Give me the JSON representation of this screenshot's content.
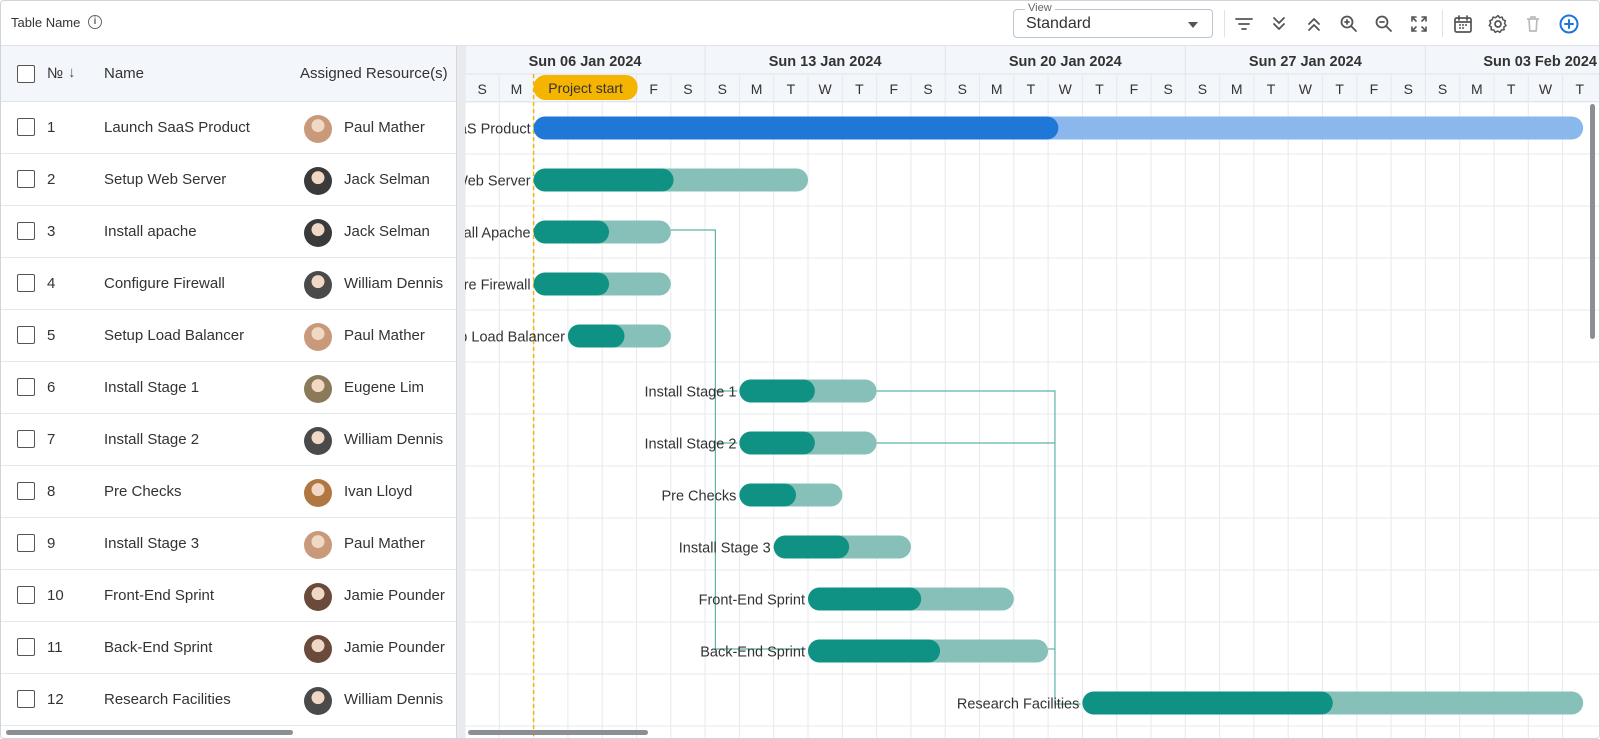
{
  "toolbar": {
    "title": "Table Name",
    "info_icon": "info-icon",
    "view_label": "View",
    "view_value": "Standard",
    "icons": [
      "filter-icon",
      "expand-all-icon",
      "collapse-all-icon",
      "zoom-in-icon",
      "zoom-out-icon",
      "fit-screen-icon",
      "calendar-icon",
      "settings-icon",
      "delete-icon",
      "add-icon"
    ]
  },
  "columns": {
    "number": "№",
    "name": "Name",
    "resource": "Assigned Resource(s)"
  },
  "rows": [
    {
      "no": "1",
      "name": "Launch SaaS Product",
      "resource": "Paul Mather"
    },
    {
      "no": "2",
      "name": "Setup Web Server",
      "resource": "Jack Selman"
    },
    {
      "no": "3",
      "name": "Install apache",
      "resource": "Jack Selman"
    },
    {
      "no": "4",
      "name": "Configure Firewall",
      "resource": "William Dennis"
    },
    {
      "no": "5",
      "name": "Setup Load Balancer",
      "resource": "Paul Mather"
    },
    {
      "no": "6",
      "name": "Install Stage 1",
      "resource": "Eugene Lim"
    },
    {
      "no": "7",
      "name": "Install Stage 2",
      "resource": "William Dennis"
    },
    {
      "no": "8",
      "name": "Pre Checks",
      "resource": "Ivan Lloyd"
    },
    {
      "no": "9",
      "name": "Install Stage 3",
      "resource": "Paul Mather"
    },
    {
      "no": "10",
      "name": "Front-End Sprint",
      "resource": "Jamie Pounder"
    },
    {
      "no": "11",
      "name": "Back-End Sprint",
      "resource": "Jamie Pounder"
    },
    {
      "no": "12",
      "name": "Research Facilities",
      "resource": "William Dennis"
    }
  ],
  "gantt": {
    "weeks": [
      "Sun 06 Jan 2024",
      "Sun 13 Jan 2024",
      "Sun 20 Jan 2024",
      "Sun 27 Jan 2024",
      "Sun 03 Feb 2024"
    ],
    "days": [
      "S",
      "M",
      "T",
      "W",
      "T",
      "F",
      "S",
      "S",
      "M",
      "T",
      "W",
      "T",
      "F",
      "S",
      "S",
      "M",
      "T",
      "W",
      "T",
      "F",
      "S",
      "S",
      "M",
      "T",
      "W",
      "T",
      "F",
      "S",
      "S",
      "M",
      "T",
      "W",
      "T"
    ],
    "project_start_label": "Project start",
    "task_labels": [
      "Launch SaaS Product",
      "Setup Web Server",
      "Install Apache",
      "Configure Firewall",
      "Setup Load Balancer",
      "Install Stage 1",
      "Install Stage 2",
      "Pre Checks",
      "Install Stage 3",
      "Front-End Sprint",
      "Back-End Sprint",
      "Research Facilities"
    ],
    "colors": {
      "primary": "#1f77d8",
      "primary_light": "#8ab8ec",
      "teal": "#0f9283",
      "teal_light": "#86c0b8",
      "milestone": "#f5b400",
      "line": "#5fb3a8"
    }
  }
}
